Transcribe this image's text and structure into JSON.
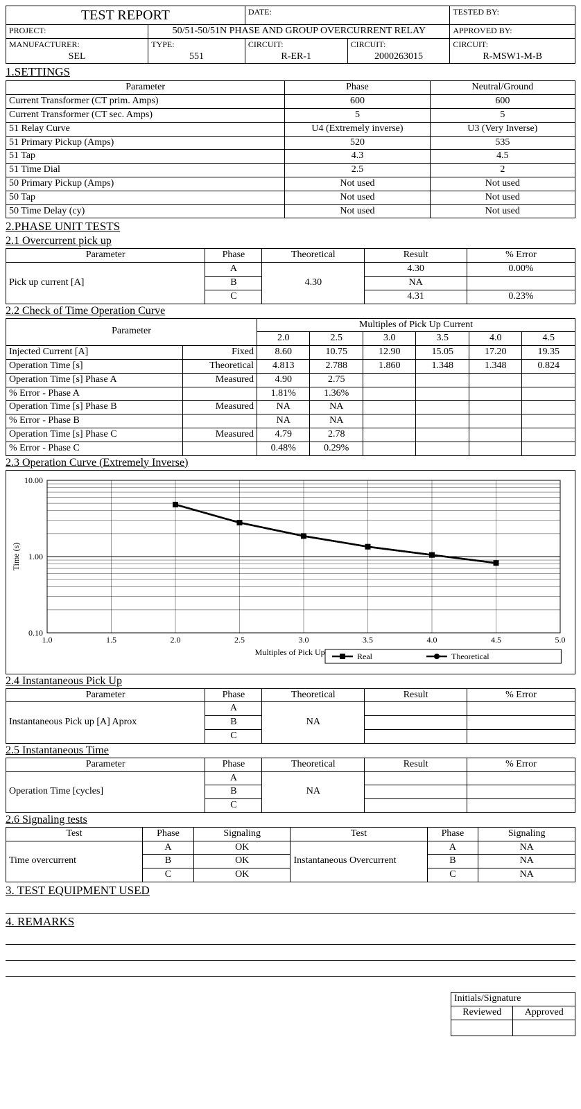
{
  "header": {
    "title": "TEST REPORT",
    "date_lbl": "DATE:",
    "date_val": "",
    "tested_lbl": "TESTED BY:",
    "tested_val": "",
    "project_lbl": "PROJECT:",
    "project_val": "50/51-50/51N PHASE AND GROUP OVERCURRENT RELAY",
    "approved_lbl": "APPROVED BY:",
    "approved_val": "",
    "mfr_lbl": "MANUFACTURER:",
    "mfr_val": "SEL",
    "type_lbl": "TYPE:",
    "type_val": "551",
    "circ1_lbl": "CIRCUIT:",
    "circ1_val": "R-ER-1",
    "circ2_lbl": "CIRCUIT:",
    "circ2_val": "2000263015",
    "circ3_lbl": "CIRCUIT:",
    "circ3_val": "R-MSW1-M-B"
  },
  "s1": {
    "title": "1.SETTINGS",
    "hdr": [
      "Parameter",
      "Phase",
      "Neutral/Ground"
    ],
    "rows": [
      [
        "Current Transformer (CT prim. Amps)",
        "600",
        "600"
      ],
      [
        "Current Transformer (CT sec. Amps)",
        "5",
        "5"
      ],
      [
        "51 Relay Curve",
        "U4 (Extremely inverse)",
        "U3 (Very Inverse)"
      ],
      [
        "51 Primary Pickup (Amps)",
        "520",
        "535"
      ],
      [
        "51 Tap",
        "4.3",
        "4.5"
      ],
      [
        "51 Time Dial",
        "2.5",
        "2"
      ],
      [
        "50 Primary Pickup (Amps)",
        "Not used",
        "Not used"
      ],
      [
        "50 Tap",
        "Not used",
        "Not used"
      ],
      [
        "50 Time Delay (cy)",
        "Not used",
        "Not used"
      ]
    ]
  },
  "s2": {
    "title": "2.PHASE UNIT TESTS"
  },
  "s21": {
    "title": "2.1 Overcurrent pick up",
    "hdr": [
      "Parameter",
      "Phase",
      "Theoretical",
      "Result",
      "% Error"
    ],
    "param": "Pick up current [A]",
    "theo": "4.30",
    "rows": [
      [
        "A",
        "4.30",
        "0.00%"
      ],
      [
        "B",
        "NA",
        ""
      ],
      [
        "C",
        "4.31",
        "0.23%"
      ]
    ]
  },
  "s22": {
    "title": "2.2 Check of Time Operation Curve",
    "param_lbl": "Parameter",
    "mult_lbl": "Multiples of Pick Up Current",
    "mult": [
      "2.0",
      "2.5",
      "3.0",
      "3.5",
      "4.0",
      "4.5"
    ],
    "rows": [
      [
        "Injected Current [A]",
        "Fixed",
        "8.60",
        "10.75",
        "12.90",
        "15.05",
        "17.20",
        "19.35"
      ],
      [
        "Operation Time [s]",
        "Theoretical",
        "4.813",
        "2.788",
        "1.860",
        "1.348",
        "1.348",
        "0.824"
      ],
      [
        "Operation Time [s]  Phase A",
        "Measured",
        "4.90",
        "2.75",
        "",
        "",
        "",
        ""
      ],
      [
        "% Error - Phase A",
        "",
        "1.81%",
        "1.36%",
        "",
        "",
        "",
        ""
      ],
      [
        "Operation Time [s]  Phase B",
        "Measured",
        "NA",
        "NA",
        "",
        "",
        "",
        ""
      ],
      [
        "% Error - Phase B",
        "",
        "NA",
        "NA",
        "",
        "",
        "",
        ""
      ],
      [
        "Operation Time [s]  Phase C",
        "Measured",
        "4.79",
        "2.78",
        "",
        "",
        "",
        ""
      ],
      [
        "% Error - Phase C",
        "",
        "0.48%",
        "0.29%",
        "",
        "",
        "",
        ""
      ]
    ]
  },
  "s23": {
    "title": "2.3  Operation Curve (Extremely Inverse)"
  },
  "chart_data": {
    "type": "line",
    "xlabel": "Multiples of Pick Up Current",
    "ylabel": "Time (s)",
    "xlim": [
      1.0,
      5.0
    ],
    "ylim": [
      0.1,
      10.0
    ],
    "yscale": "log",
    "x": [
      2.0,
      2.5,
      3.0,
      3.5,
      4.0,
      4.5
    ],
    "series": [
      {
        "name": "Real",
        "marker": "square",
        "values": [
          4.813,
          2.788,
          1.86,
          1.348,
          1.05,
          0.824
        ]
      },
      {
        "name": "Theoretical",
        "marker": "circle",
        "values": [
          4.813,
          2.788,
          1.86,
          1.348,
          1.05,
          0.824
        ]
      }
    ],
    "legend": [
      "Real",
      "Theoretical"
    ]
  },
  "s24": {
    "title": "2.4  Instantaneous Pick Up",
    "hdr": [
      "Parameter",
      "Phase",
      "Theoretical",
      "Result",
      "% Error"
    ],
    "param": "Instantaneous Pick up  [A]  Aprox",
    "theo": "NA",
    "phases": [
      "A",
      "B",
      "C"
    ]
  },
  "s25": {
    "title": "2.5  Instantaneous  Time",
    "hdr": [
      "Parameter",
      "Phase",
      "Theoretical",
      "Result",
      "% Error"
    ],
    "param": "Operation Time [cycles]",
    "theo": "NA",
    "phases": [
      "A",
      "B",
      "C"
    ]
  },
  "s26": {
    "title": "2.6  Signaling tests",
    "hdr": [
      "Test",
      "Phase",
      "Signaling",
      "Test",
      "Phase",
      "Signaling"
    ],
    "left_test": "Time overcurrent",
    "right_test": "Instantaneous Overcurrent",
    "rows": [
      [
        "A",
        "OK",
        "A",
        "NA"
      ],
      [
        "B",
        "OK",
        "B",
        "NA"
      ],
      [
        "C",
        "OK",
        "C",
        "NA"
      ]
    ]
  },
  "s3": {
    "title": "3.  TEST EQUIPMENT USED"
  },
  "s4": {
    "title": "4.  REMARKS"
  },
  "sig": {
    "title": "Initials/Signature",
    "reviewed": "Reviewed",
    "approved": "Approved"
  }
}
